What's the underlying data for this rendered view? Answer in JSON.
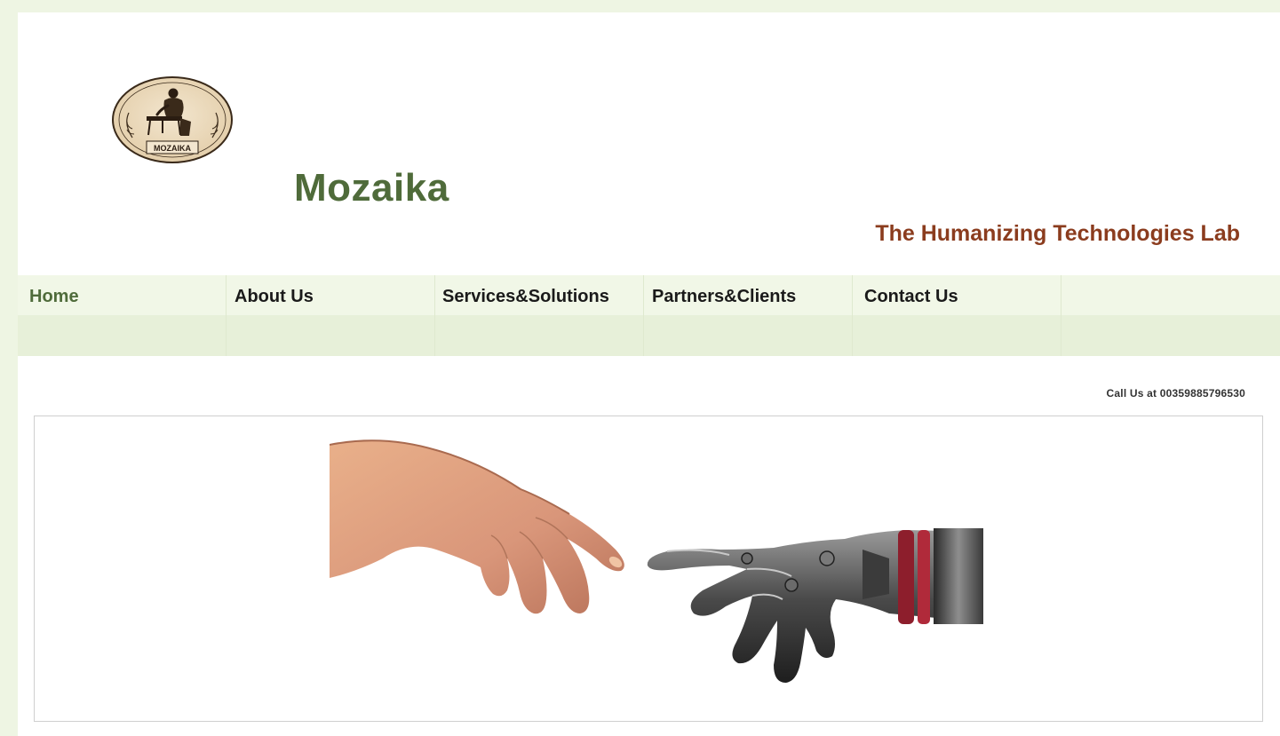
{
  "site": {
    "logo_text": "MOZAIKA",
    "name": "Mozaika",
    "tagline": "The Humanizing Technologies Lab"
  },
  "nav": {
    "items": [
      {
        "label": "Home",
        "active": true
      },
      {
        "label": "About Us",
        "active": false
      },
      {
        "label": "Services&Solutions",
        "active": false
      },
      {
        "label": "Partners&Clients",
        "active": false
      },
      {
        "label": "Contact Us",
        "active": false
      }
    ]
  },
  "contact": {
    "call_text": "Call Us at 00359885796530"
  },
  "colors": {
    "brand_green": "#4f6b3a",
    "tagline_brown": "#8b3c1e",
    "nav_background": "#f1f7e7",
    "page_background": "#eef5e3"
  },
  "banner": {
    "icon": "human-robot-hand-image"
  }
}
